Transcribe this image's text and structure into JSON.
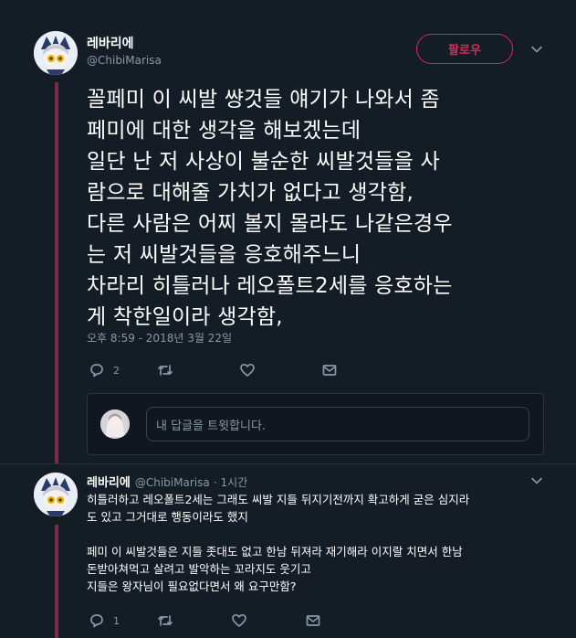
{
  "main_tweet": {
    "author_name": "레바리에",
    "author_handle": "@ChibiMarisa",
    "follow_label": "팔로우",
    "text": "꼴페미 이 씨발 썅것들 얘기가 나와서 좀\n페미에 대한 생각을 해보겠는데\n일단 난 저 사상이 불순한 씨발것들을 사\n람으로 대해줄 가치가 없다고 생각함,\n다른 사람은 어찌 볼지 몰라도 나같은경우\n는 저 씨발것들을 응호해주느니\n차라리 히틀러나 레오폴트2세를 응호하는\n게 착한일이라 생각함,",
    "timestamp": "오후 8:59 - 2018년 3월 22일",
    "reply_count": "2",
    "retweet_count": "",
    "like_count": ""
  },
  "reply_box": {
    "placeholder": "내 답글을 트윗합니다."
  },
  "reply_tweet": {
    "author_name": "레바리에",
    "author_handle": "@ChibiMarisa",
    "separator": "·",
    "time_ago": "1시간",
    "text": "히틀러하고 레오폴트2세는 그래도 씨발 지들 뒤지기전까지 확고하게 굳은 심지라\n도 있고 그거대로 행동이라도 했지\n\n페미 이 씨발것들은 지들 좃대도 없고 한남 뒤져라 재기해라 이지랄 치면서 한남\n돈받아쳐먹고 살려고 발악하는 꼬라지도 웃기고\n지들은 왕자님이 필요없다면서 왜 요구만함?",
    "reply_count": "1"
  },
  "colors": {
    "background": "#141d26",
    "thread_line": "#7b2b44",
    "follow_accent": "#e0245e",
    "muted": "#8899a6"
  }
}
